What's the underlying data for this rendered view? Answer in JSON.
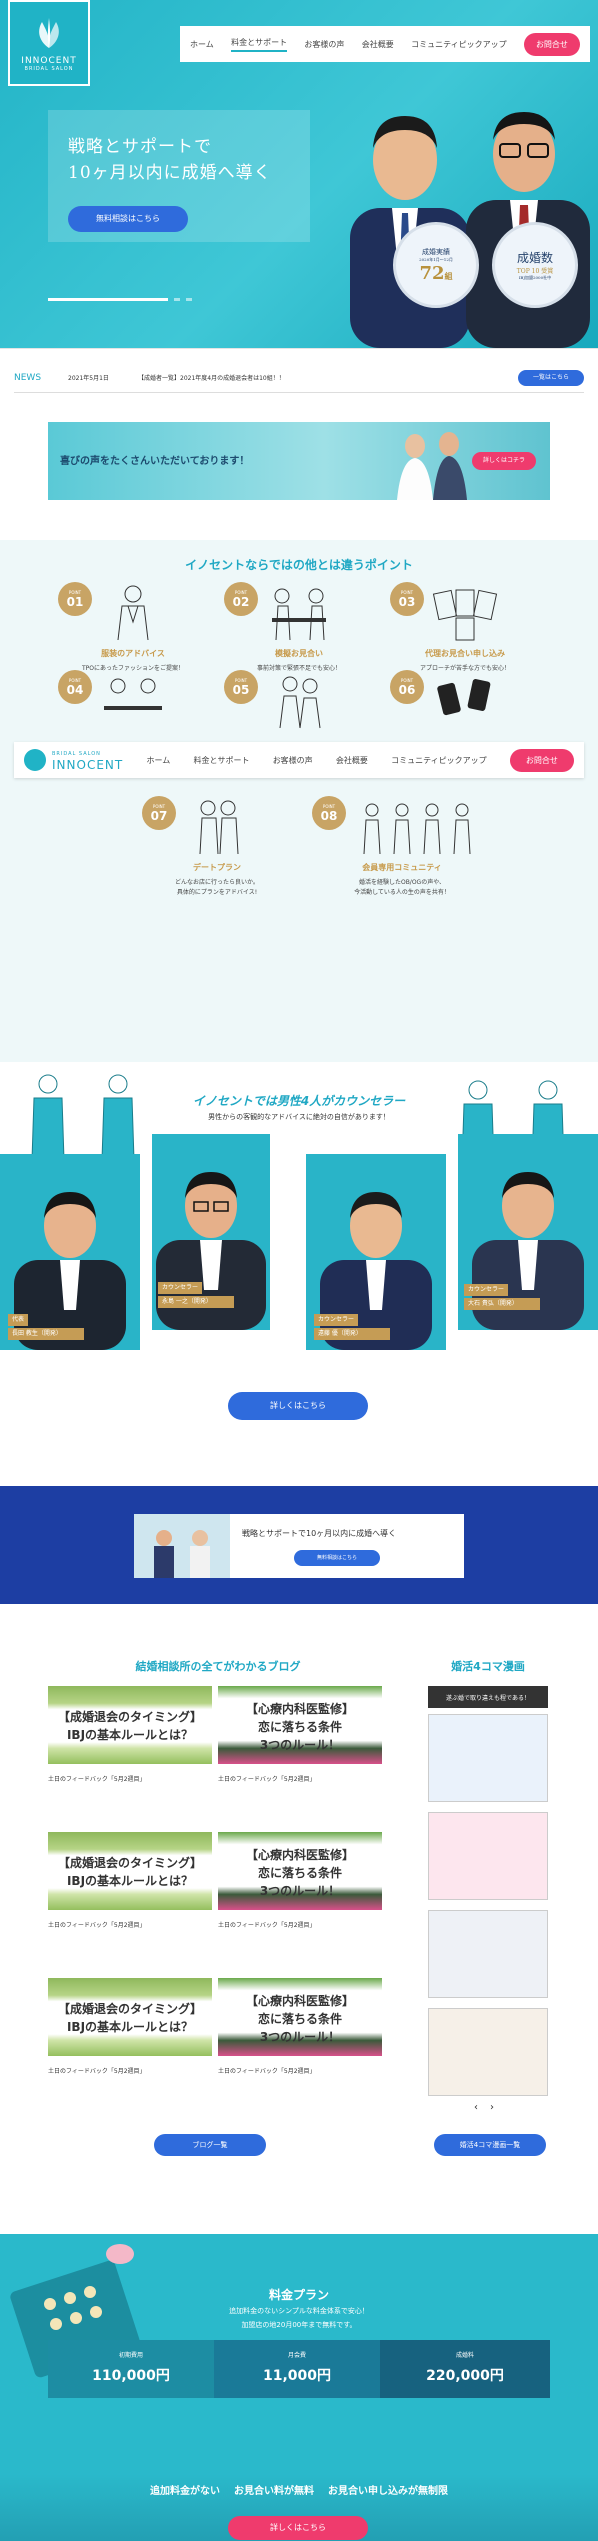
{
  "brand": {
    "name": "INNOCENT",
    "tagline": "BRIDAL SALON",
    "accent": "#20b3c6",
    "cta": "#ef3b6d",
    "gold": "#c59c55",
    "navy": "#1d3ea3"
  },
  "nav": {
    "items": [
      "ホーム",
      "料金とサポート",
      "お客様の声",
      "会社概要",
      "コミュニティピックアップ"
    ],
    "cta": "お問合せ"
  },
  "hero": {
    "catch1": "戦略とサポートで",
    "catch2": "10ヶ月以内に成婚へ導く",
    "button": "無料相談はこちら",
    "medal1": {
      "label": "成婚実績",
      "period": "2020年1月〜12月",
      "value": "72",
      "unit": "組"
    },
    "medal2": {
      "label": "成婚数",
      "sub": "TOP 10 受賞",
      "note": "IBJ加盟2000社中"
    }
  },
  "news": {
    "label": "NEWS",
    "date": "2021年5月1日",
    "text": "【成婚者一覧】2021年度4月の成婚退会者は10組！！",
    "button": "一覧はこちら"
  },
  "voice": {
    "text": "喜びの声をたくさんいただいております！",
    "button": "詳しくはコチラ"
  },
  "points": {
    "title": "イノセントならではの他とは違うポイント",
    "point_label": "POINT",
    "items": [
      {
        "num": "01",
        "title": "服装のアドバイス",
        "desc": "TPOにあったファッションをご提案！"
      },
      {
        "num": "02",
        "title": "模擬お見合い",
        "desc": "事前対策で緊張不足でも安心！"
      },
      {
        "num": "03",
        "title": "代理お見合い申し込み",
        "desc": "アプローチが苦手な方でも安心！"
      },
      {
        "num": "04",
        "title": "",
        "desc": ""
      },
      {
        "num": "05",
        "title": "",
        "desc": ""
      },
      {
        "num": "06",
        "title": "",
        "desc": ""
      },
      {
        "num": "07",
        "title": "デートプラン",
        "desc": "どんなお店に行ったら良いか。",
        "desc2": "具体的にプランをアドバイス!"
      },
      {
        "num": "08",
        "title": "会員専用コミュニティ",
        "desc": "婚活を経験したOB/OGの声や、",
        "desc2": "今活動している人の生の声を共有！"
      }
    ]
  },
  "counselor": {
    "title": "イノセントでは男性4人がカウンセラー",
    "sub": "男性からの客観的なアドバイスに絶対の自信があります！",
    "people": [
      {
        "role": "代表",
        "name": "長田 教生（開発）"
      },
      {
        "role": "カウンセラー",
        "name": "永島 一之（開発）"
      },
      {
        "role": "カウンセラー",
        "name": "遠藤 優（開発）"
      },
      {
        "role": "カウンセラー",
        "name": "大石 貴弘（開発）"
      }
    ],
    "button": "詳しくはこちら"
  },
  "band": {
    "text": "戦略とサポートで10ヶ月以内に成婚へ導く",
    "button": "無料相談はこちら"
  },
  "blog": {
    "title": "結婚相談所の全てがわかるブログ",
    "button": "ブログ一覧",
    "posts": [
      {
        "l1": "【成婚退会のタイミング】",
        "l2": "IBJの基本ルールとは？",
        "cap": "土日のフィードバック「5月2週目」"
      },
      {
        "l1": "【心療内科医監修】",
        "l2": "恋に落ちる条件",
        "l3": "3つのルール！",
        "cap": "土日のフィードバック「5月2週目」"
      },
      {
        "l1": "【成婚退会のタイミング】",
        "l2": "IBJの基本ルールとは？",
        "cap": "土日のフィードバック「5月2週目」"
      },
      {
        "l1": "【心療内科医監修】",
        "l2": "恋に落ちる条件",
        "l3": "3つのルール！",
        "cap": "土日のフィードバック「5月2週目」"
      },
      {
        "l1": "【成婚退会のタイミング】",
        "l2": "IBJの基本ルールとは？",
        "cap": "土日のフィードバック「5月2週目」"
      },
      {
        "l1": "【心療内科医監修】",
        "l2": "恋に落ちる条件",
        "l3": "3つのルール！",
        "cap": "土日のフィードバック「5月2週目」"
      }
    ]
  },
  "manga": {
    "title": "婚活4コマ漫画",
    "head": "遂ぶ婚で取り違えも程である！",
    "button": "婚活4コマ漫画一覧"
  },
  "price": {
    "title": "料金プラン",
    "sub1": "追加料金のないシンプルな料金体系で安心！",
    "sub2": "加盟店の地20月00年まで無料です。",
    "cols": [
      {
        "label": "初期費用",
        "value": "110,000円"
      },
      {
        "label": "月会費",
        "value": "11,000円"
      },
      {
        "label": "成婚料",
        "value": "220,000円"
      }
    ],
    "bottom": [
      "追加料金がない",
      "お見合い料が無料",
      "お見合い申し込みが無制限"
    ],
    "button": "詳しくはこちら"
  }
}
